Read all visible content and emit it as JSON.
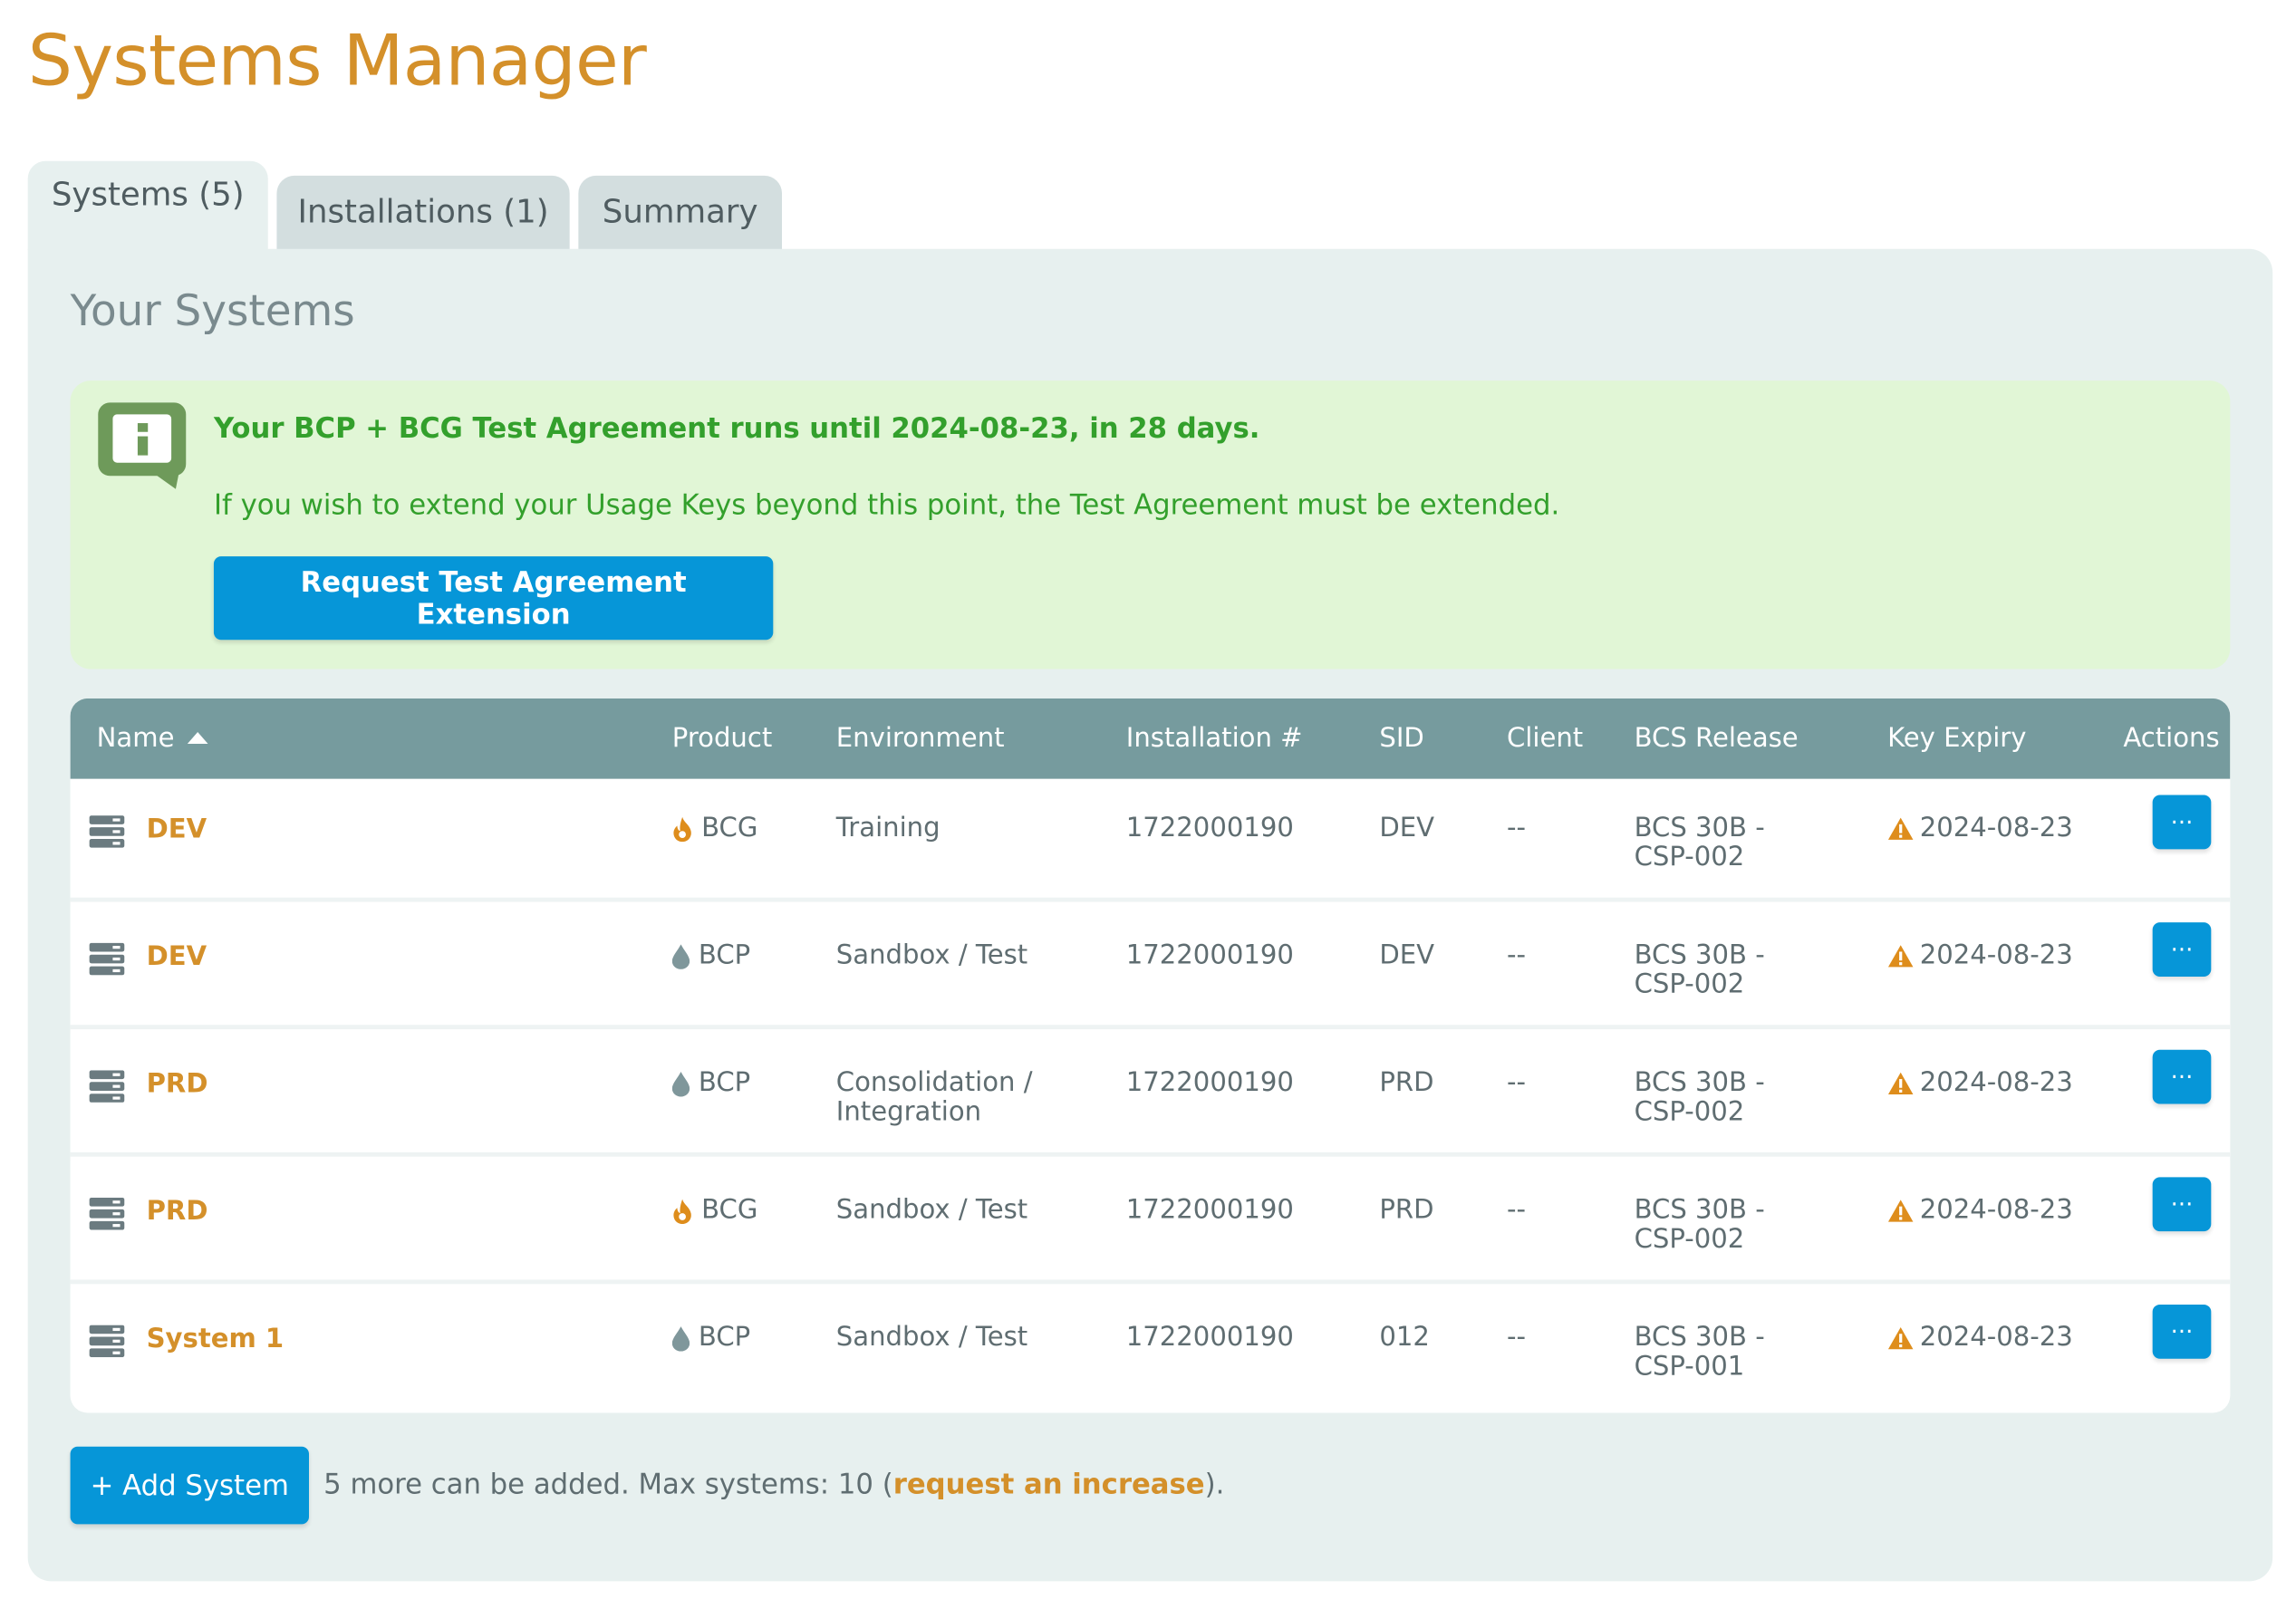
{
  "app": {
    "title": "Systems Manager"
  },
  "tabs": [
    {
      "label": "Systems (5)",
      "active": true
    },
    {
      "label": "Installations (1)",
      "active": false
    },
    {
      "label": "Summary",
      "active": false
    }
  ],
  "section": {
    "title": "Your Systems"
  },
  "notice": {
    "headline": "Your BCP + BCG Test Agreement runs until 2024-08-23, in 28 days.",
    "body": "If you wish to extend your Usage Keys beyond this point, the Test Agreement must be extended.",
    "button_label": "Request Test Agreement Extension",
    "icon": "info-icon"
  },
  "table": {
    "columns": {
      "name": "Name",
      "product": "Product",
      "environment": "Environment",
      "installation": "Installation #",
      "sid": "SID",
      "client": "Client",
      "release": "BCS Release",
      "expiry": "Key Expiry",
      "actions": "Actions"
    },
    "sort": {
      "column": "name",
      "direction": "ascending"
    },
    "action_label": "···",
    "rows": [
      {
        "name": "DEV",
        "product": "BCG",
        "product_icon": "flame-icon",
        "environment_1": "Training",
        "environment_2": "",
        "installation": "1722000190",
        "sid": "DEV",
        "client": "--",
        "release_1": "BCS 30B -",
        "release_2": "CSP-002",
        "expiry": "2024-08-23"
      },
      {
        "name": "DEV",
        "product": "BCP",
        "product_icon": "drop-icon",
        "environment_1": "Sandbox / Test",
        "environment_2": "",
        "installation": "1722000190",
        "sid": "DEV",
        "client": "--",
        "release_1": "BCS 30B -",
        "release_2": "CSP-002",
        "expiry": "2024-08-23"
      },
      {
        "name": "PRD",
        "product": "BCP",
        "product_icon": "drop-icon",
        "environment_1": "Consolidation /",
        "environment_2": "Integration",
        "installation": "1722000190",
        "sid": "PRD",
        "client": "--",
        "release_1": "BCS 30B -",
        "release_2": "CSP-002",
        "expiry": "2024-08-23"
      },
      {
        "name": "PRD",
        "product": "BCG",
        "product_icon": "flame-icon",
        "environment_1": "Sandbox / Test",
        "environment_2": "",
        "installation": "1722000190",
        "sid": "PRD",
        "client": "--",
        "release_1": "BCS 30B -",
        "release_2": "CSP-002",
        "expiry": "2024-08-23"
      },
      {
        "name": "System 1",
        "product": "BCP",
        "product_icon": "drop-icon",
        "environment_1": "Sandbox / Test",
        "environment_2": "",
        "installation": "1722000190",
        "sid": "012",
        "client": "--",
        "release_1": "BCS 30B -",
        "release_2": "CSP-001",
        "expiry": "2024-08-23"
      }
    ]
  },
  "footer": {
    "add_button_label": "+ Add System",
    "limit_text_prefix": "5 more can be added. Max systems: 10 (",
    "limit_link": "request an increase",
    "limit_text_suffix": ")."
  },
  "colors": {
    "brand_orange": "#d4902a",
    "primary_blue": "#0696d8",
    "header_teal": "#769b9e",
    "panel_bg": "#e7f0ef",
    "notice_bg": "#e1f6d6",
    "notice_text": "#33a02c",
    "warning_orange": "#de8d1c",
    "drop_gray": "#7f979b"
  }
}
